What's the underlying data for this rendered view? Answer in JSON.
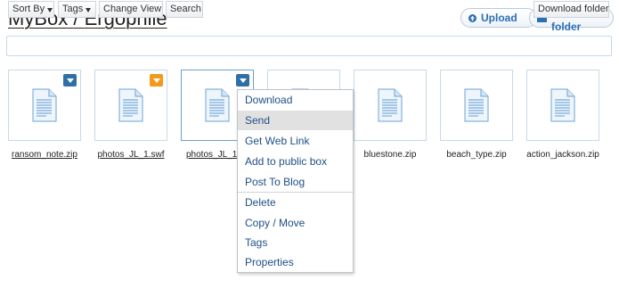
{
  "header": {
    "breadcrumb_root": "MyBox",
    "breadcrumb_separator": "/",
    "breadcrumb_folder": "Ergophile"
  },
  "actions": {
    "upload_label": "Upload",
    "new_folder_label": "New folder"
  },
  "toolbar": {
    "sort_by": "Sort By",
    "tags": "Tags",
    "change_view": "Change View",
    "search": "Search",
    "download_folder": "Download folder"
  },
  "files": [
    {
      "name": "ransom_note.zip",
      "badge": "blue",
      "underlined": true
    },
    {
      "name": "photos_JL_1.swf",
      "badge": "orange",
      "underlined": true
    },
    {
      "name": "photos_JL_1",
      "badge": "blue",
      "underlined": true
    },
    {
      "name": "",
      "badge": "none",
      "underlined": false
    },
    {
      "name": "bluestone.zip",
      "badge": "none",
      "underlined": false
    },
    {
      "name": "beach_type.zip",
      "badge": "none",
      "underlined": false
    },
    {
      "name": "action_jackson.zip",
      "badge": "none",
      "underlined": false
    }
  ],
  "context_menu": {
    "items": [
      "Download",
      "Send",
      "Get Web Link",
      "Add to public box",
      "Post To Blog",
      "Delete",
      "Copy / Move",
      "Tags",
      "Properties"
    ],
    "highlighted": "Send"
  },
  "colors": {
    "accent": "#2a6fb4",
    "badge_blue": "#2f6fa8",
    "badge_orange": "#f39a1c",
    "menu_text": "#1f4f86"
  }
}
